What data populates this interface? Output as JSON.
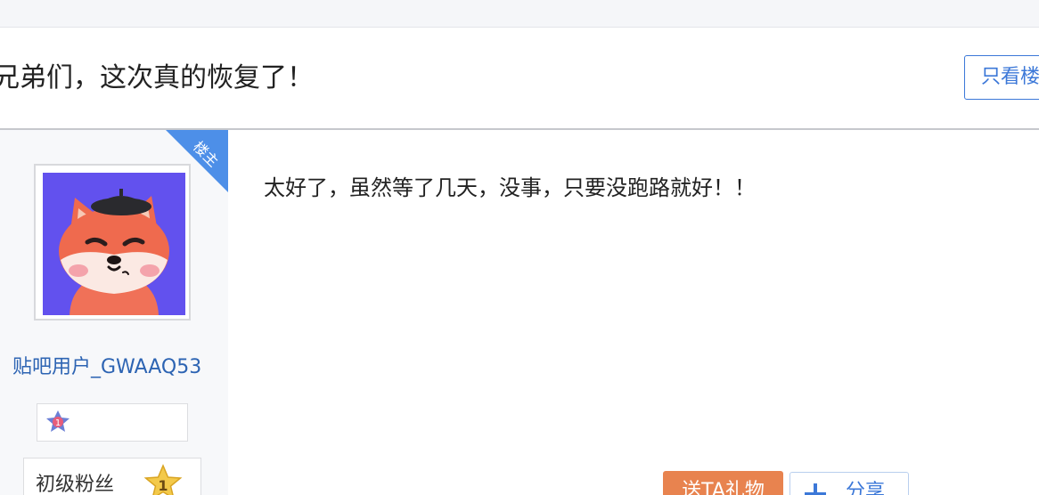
{
  "thread": {
    "title": "兄弟们，这次真的恢复了！",
    "only_op_label": "只看楼主"
  },
  "author": {
    "op_tag": "楼主",
    "username": "贴吧用户_GWAAQ53",
    "level_title": "初级粉丝",
    "level_number": "1",
    "avatar_icon": "fox-avatar-icon",
    "badge_icon": "member-badge-icon"
  },
  "post": {
    "content": "太好了，虽然等了几天，没事，只要没跑路就好！！"
  },
  "actions": {
    "gift_label": "送TA礼物",
    "share_label": "分享"
  },
  "colors": {
    "link_blue": "#2d64b3",
    "accent_blue": "#3c78d8",
    "ribbon_blue": "#4d8fe8",
    "gift_orange": "#e8834f",
    "avatar_bg": "#6251ee"
  }
}
